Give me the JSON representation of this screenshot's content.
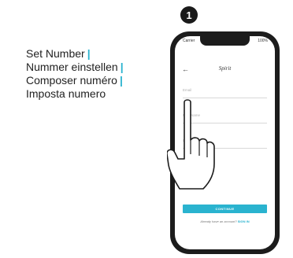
{
  "step": {
    "number": "1"
  },
  "instructions": {
    "lines": [
      "Set Number",
      "Nummer einstellen",
      "Composer numéro",
      "Imposta numero"
    ],
    "separator": "|",
    "accent_color": "#2ab3cf"
  },
  "phone": {
    "status_left": "Carrier",
    "status_right": "100%",
    "back_icon": "arrow-left-icon",
    "app_title": "Spirit",
    "fields": {
      "email_placeholder": "Email",
      "first_name_placeholder": "First Name",
      "last_name_placeholder": "Last"
    },
    "continue_label": "CONTINUE",
    "signin_prompt": "Already have an account?",
    "signin_link": "SIGN IN"
  }
}
